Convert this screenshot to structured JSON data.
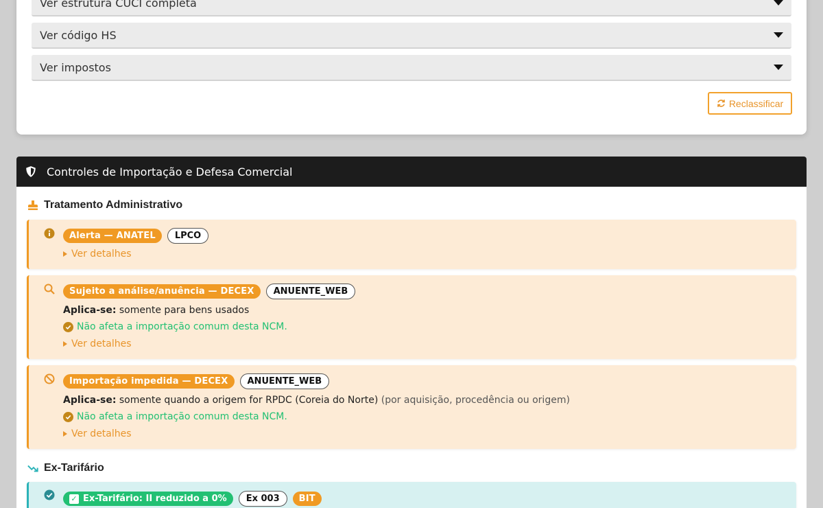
{
  "accordions": [
    {
      "label": "Ver estrutura CUCI completa"
    },
    {
      "label": "Ver código HS"
    },
    {
      "label": "Ver impostos"
    }
  ],
  "reclassify_label": "Reclassificar",
  "controls": {
    "header": "Controles de Importação e Defesa Comercial",
    "admin_title": "Tratamento Administrativo",
    "items": [
      {
        "badge": "Alerta — ANATEL",
        "tag": "LPCO",
        "details": "Ver detalhes"
      },
      {
        "badge": "Sujeito a análise/anuência — DECEX",
        "tag": "ANUENTE_WEB",
        "applies_label": "Aplica-se:",
        "applies_text": "somente para bens usados",
        "ok_text": "Não afeta a importação comum desta NCM.",
        "details": "Ver detalhes"
      },
      {
        "badge": "Importação impedida — DECEX",
        "tag": "ANUENTE_WEB",
        "applies_label": "Aplica-se:",
        "applies_text": "somente quando a origem for RPDC (Coreia do Norte)",
        "applies_note": "(por aquisição, procedência ou origem)",
        "ok_text": "Não afeta a importação comum desta NCM.",
        "details": "Ver detalhes"
      }
    ],
    "ex_title": "Ex-Tarifário",
    "ex_item": {
      "badge": "Ex-Tarifário: II reduzido a 0%",
      "tag": "Ex 003",
      "tag2": "BIT"
    }
  },
  "colors": {
    "accent": "#f09a24",
    "success": "#22c073",
    "teal": "#2bb3b8",
    "header_bg": "#1c1c1c"
  }
}
